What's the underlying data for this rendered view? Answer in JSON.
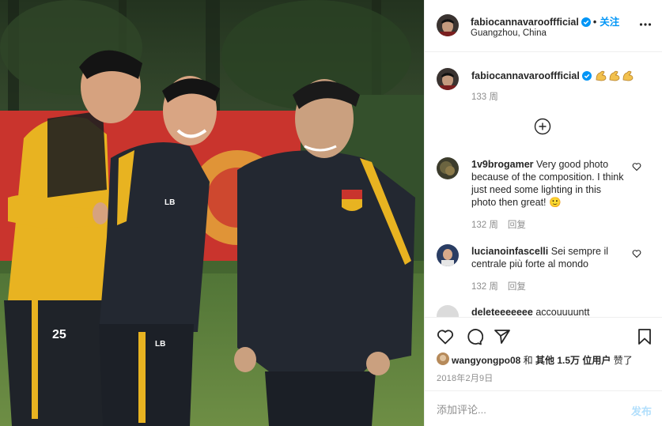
{
  "post": {
    "username": "fabiocannavarooffficial",
    "follow_label": "关注",
    "location": "Guangzhou, China",
    "more_icon": "more-horizontal-icon"
  },
  "photo": {
    "jersey_left": "25",
    "jersey_mid_chest": "LB",
    "jersey_mid_short": "LB",
    "colors": {
      "yellow": "#e8b321",
      "navy": "#232831",
      "pitch": "#5a7d3a",
      "banner_red": "#c9342d"
    }
  },
  "caption": {
    "username": "fabiocannavarooffficial",
    "emoji": "flexed-biceps-emoji x3",
    "time": "133 周"
  },
  "load_more_icon": "plus-circle-icon",
  "comments": [
    {
      "username": "1v9brogamer",
      "text": "Very good photo because of the composition. I think just need some lighting in this photo then great! 🙂",
      "time": "132 周",
      "reply": "回复"
    },
    {
      "username": "lucianoinfascelli",
      "text": "Sei sempre il centrale più forte al mondo",
      "time": "132 周",
      "reply": "回复"
    },
    {
      "username": "deleteeeeeee",
      "text": "accouuuuntt"
    }
  ],
  "actions": {
    "like_icon": "heart-icon",
    "comment_icon": "comment-icon",
    "share_icon": "paper-plane-icon",
    "save_icon": "bookmark-icon"
  },
  "likes": {
    "username": "wangyongpo08",
    "joiner": " 和 ",
    "others": "其他 1.5万 位用户",
    "suffix": " 赞了"
  },
  "date": "2018年2月9日",
  "add_comment": {
    "placeholder": "添加评论...",
    "post_label": "发布"
  },
  "accent_color": "#0095f6"
}
